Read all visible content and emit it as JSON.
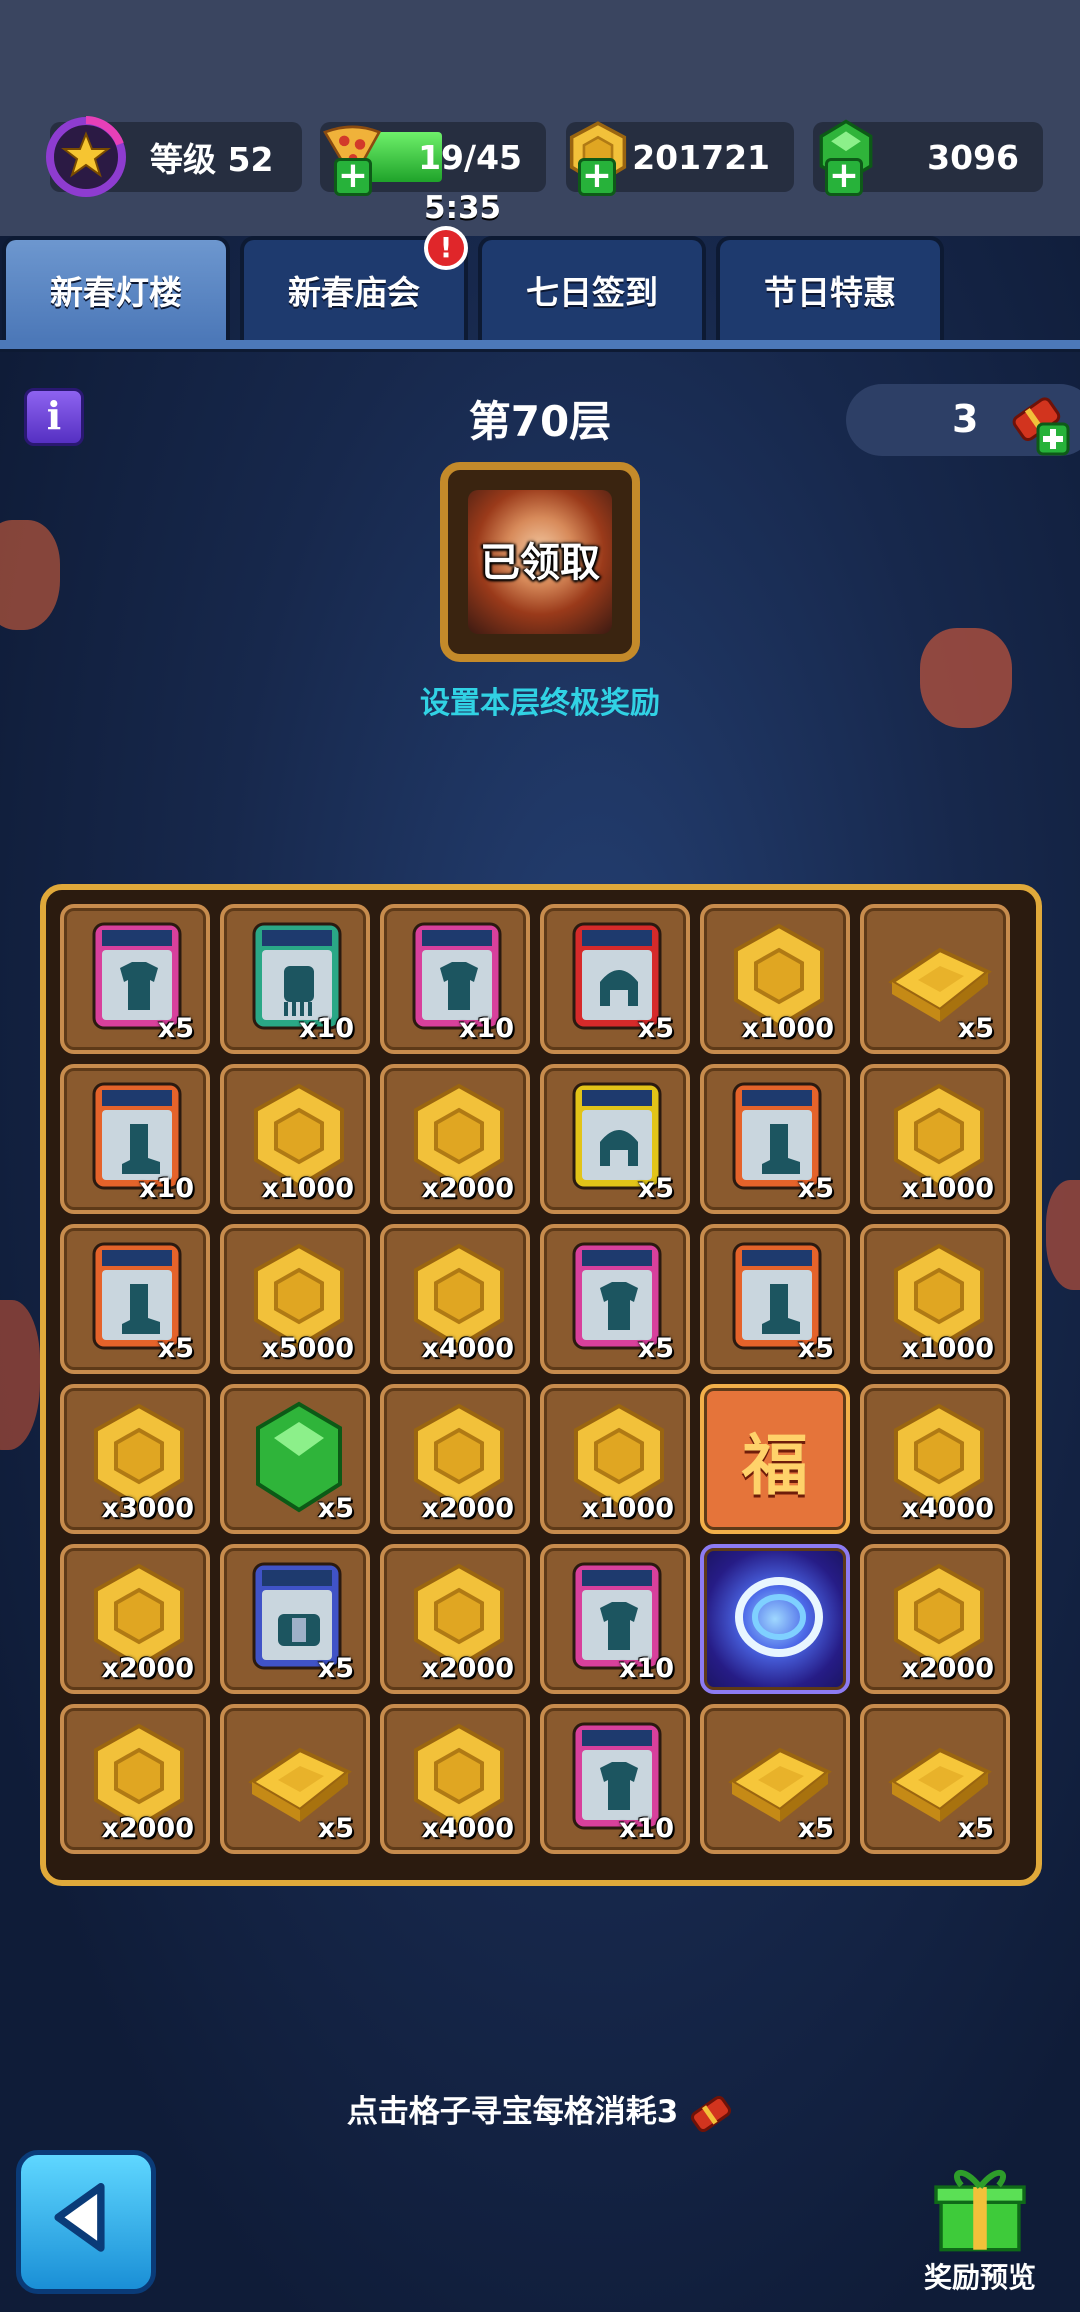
{
  "status": {
    "level_label": "等级 52",
    "energy_text": "19/45",
    "energy_fill": 0.42,
    "energy_timer": "5:35",
    "gold": "201721",
    "gems": "3096"
  },
  "tabs": [
    {
      "label": "新春灯楼",
      "active": true
    },
    {
      "label": "新春庙会",
      "active": false,
      "alert": "!"
    },
    {
      "label": "七日签到",
      "active": false
    },
    {
      "label": "节日特惠",
      "active": false
    }
  ],
  "floor": {
    "info_label": "i",
    "title": "第70层",
    "tickets": "3",
    "ultimate_reward_status": "已领取",
    "set_reward_link": "设置本层终极奖励"
  },
  "grid": [
    [
      {
        "item": "armor-card-pink",
        "qty": "x5"
      },
      {
        "item": "gloves-card-teal",
        "qty": "x10"
      },
      {
        "item": "armor-card-pink",
        "qty": "x10"
      },
      {
        "item": "helmet-card-red",
        "qty": "x5"
      },
      {
        "item": "gold-coin",
        "qty": "x1000"
      },
      {
        "item": "gold-bar",
        "qty": "x5"
      }
    ],
    [
      {
        "item": "boots-card-orange",
        "qty": "x10"
      },
      {
        "item": "gold-coin",
        "qty": "x1000"
      },
      {
        "item": "gold-coin",
        "qty": "x2000"
      },
      {
        "item": "helmet-card-yellow",
        "qty": "x5"
      },
      {
        "item": "boots-card-orange",
        "qty": "x5"
      },
      {
        "item": "gold-coin",
        "qty": "x1000"
      }
    ],
    [
      {
        "item": "boots-card-orange",
        "qty": "x5"
      },
      {
        "item": "gold-coin",
        "qty": "x5000"
      },
      {
        "item": "gold-coin",
        "qty": "x4000"
      },
      {
        "item": "armor-card-pink",
        "qty": "x5"
      },
      {
        "item": "boots-card-orange",
        "qty": "x5"
      },
      {
        "item": "gold-coin",
        "qty": "x1000"
      }
    ],
    [
      {
        "item": "gold-coin",
        "qty": "x3000"
      },
      {
        "item": "green-gem",
        "qty": "x5"
      },
      {
        "item": "gold-coin",
        "qty": "x2000"
      },
      {
        "item": "gold-coin",
        "qty": "x1000"
      },
      {
        "item": "fu-tile",
        "qty": "",
        "label": "福"
      },
      {
        "item": "gold-coin",
        "qty": "x4000"
      }
    ],
    [
      {
        "item": "gold-coin",
        "qty": "x2000"
      },
      {
        "item": "belt-card-blue",
        "qty": "x5"
      },
      {
        "item": "gold-coin",
        "qty": "x2000"
      },
      {
        "item": "armor-card-pink",
        "qty": "x10"
      },
      {
        "item": "portal",
        "qty": ""
      },
      {
        "item": "gold-coin",
        "qty": "x2000"
      }
    ],
    [
      {
        "item": "gold-coin",
        "qty": "x2000"
      },
      {
        "item": "gold-bar",
        "qty": "x5"
      },
      {
        "item": "gold-coin",
        "qty": "x4000"
      },
      {
        "item": "armor-card-pink",
        "qty": "x10"
      },
      {
        "item": "gold-bar",
        "qty": "x5"
      },
      {
        "item": "gold-bar",
        "qty": "x5"
      }
    ]
  ],
  "footer": {
    "hint": "点击格子寻宝每格消耗3",
    "back_icon": "back-arrow-icon",
    "preview_label": "奖励预览"
  },
  "colors": {
    "card_pink": "#d8409c",
    "card_teal": "#2aa886",
    "card_red": "#d62a2a",
    "card_yellow": "#e2c418",
    "card_orange": "#e5632a",
    "card_blue": "#4053c7",
    "gold": "#f2c13a",
    "gem_green": "#2fb43a",
    "board_border": "#e0a93a"
  }
}
